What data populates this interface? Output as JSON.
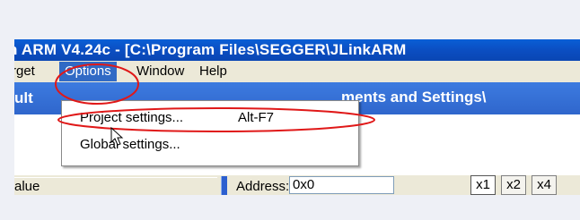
{
  "window": {
    "title": "n ARM V4.24c - [C:\\Program Files\\SEGGER\\JLinkARM"
  },
  "menubar": {
    "items": [
      {
        "label": "rget"
      },
      {
        "label": "Options"
      },
      {
        "label": "Window"
      },
      {
        "label": "Help"
      }
    ]
  },
  "dropdown": {
    "items": [
      {
        "label": "Project settings...",
        "shortcut": "Alt-F7"
      },
      {
        "label": "Global settings..."
      }
    ]
  },
  "panes": {
    "left_title": "ult",
    "right_title": "ments and Settings\\"
  },
  "table": {
    "column_header": "alue"
  },
  "memory": {
    "address_label": "Address:",
    "address_value": "0x0",
    "zoom_buttons": [
      "x1",
      "x2",
      "x4"
    ]
  },
  "colors": {
    "annotation_red": "#e01818",
    "menu_highlight": "#316ac5",
    "titlebar_blue": "#0b4ec2"
  }
}
